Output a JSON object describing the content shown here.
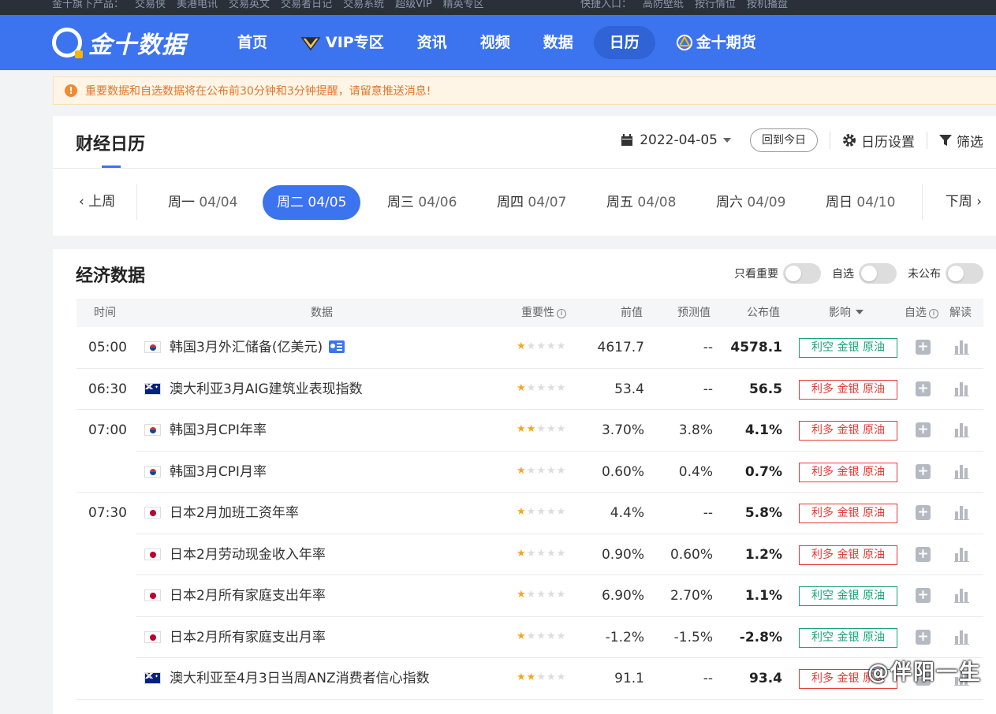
{
  "topbar": {
    "items": [
      "金十旗下产品：",
      "交易侠",
      "美港电讯",
      "交易英文",
      "交易者日记",
      "交易系统",
      "超级VIP",
      "精英专区"
    ],
    "quick": [
      "快捷入口：",
      "高防壁纸",
      "按行情位",
      "按机播盘"
    ]
  },
  "brand": {
    "name": "金十数据",
    "primary_color": "#3c74ef"
  },
  "nav": {
    "items": [
      {
        "label": "首页"
      },
      {
        "label": "VIP专区",
        "icon": "vip-diamond-icon"
      },
      {
        "label": "资讯"
      },
      {
        "label": "视频"
      },
      {
        "label": "数据"
      },
      {
        "label": "日历",
        "active": true
      },
      {
        "label": "金十期货",
        "icon": "futures-logo-icon"
      }
    ]
  },
  "notice": {
    "text": "重要数据和自选数据将在公布前30分钟和3分钟提醒，请留意推送消息!"
  },
  "calendar": {
    "title": "财经日历",
    "date": "2022-04-05",
    "today_button": "回到今日",
    "settings": "日历设置",
    "filter": "筛选",
    "prev_week": "上周",
    "next_week": "下周",
    "days": [
      {
        "wd": "周一",
        "date": "04/04"
      },
      {
        "wd": "周二",
        "date": "04/05",
        "active": true
      },
      {
        "wd": "周三",
        "date": "04/06"
      },
      {
        "wd": "周四",
        "date": "04/07"
      },
      {
        "wd": "周五",
        "date": "04/08"
      },
      {
        "wd": "周六",
        "date": "04/09"
      },
      {
        "wd": "周日",
        "date": "04/10"
      }
    ]
  },
  "econ": {
    "title": "经济数据",
    "toggles": [
      "只看重要",
      "自选",
      "未公布"
    ],
    "headers": {
      "time": "时间",
      "data": "数据",
      "importance": "重要性",
      "prev": "前值",
      "forecast": "预测值",
      "actual": "公布值",
      "impact": "影响",
      "watch": "自选",
      "interpret": "解读"
    },
    "rows": [
      {
        "time": "05:00",
        "flag": "kr",
        "name": "韩国3月外汇储备(亿美元)",
        "news": true,
        "stars": 1,
        "prev": "4617.7",
        "forecast": "--",
        "actual": "4578.1",
        "impact": "利空 金银 原油",
        "bull": false
      },
      {
        "time": "06:30",
        "flag": "au",
        "name": "澳大利亚3月AIG建筑业表现指数",
        "stars": 1,
        "prev": "53.4",
        "forecast": "--",
        "actual": "56.5",
        "impact": "利多 金银 原油",
        "bull": true
      },
      {
        "time": "07:00",
        "flag": "kr",
        "name": "韩国3月CPI年率",
        "stars": 2,
        "prev": "3.70%",
        "forecast": "3.8%",
        "actual": "4.1%",
        "impact": "利多 金银 原油",
        "bull": true
      },
      {
        "time": "",
        "flag": "kr",
        "name": "韩国3月CPI月率",
        "stars": 1,
        "prev": "0.60%",
        "forecast": "0.4%",
        "actual": "0.7%",
        "impact": "利多 金银 原油",
        "bull": true
      },
      {
        "time": "07:30",
        "flag": "jp",
        "name": "日本2月加班工资年率",
        "stars": 1,
        "prev": "4.4%",
        "forecast": "--",
        "actual": "5.8%",
        "impact": "利多 金银 原油",
        "bull": true
      },
      {
        "time": "",
        "flag": "jp",
        "name": "日本2月劳动现金收入年率",
        "stars": 1,
        "prev": "0.90%",
        "forecast": "0.60%",
        "actual": "1.2%",
        "impact": "利多 金银 原油",
        "bull": true
      },
      {
        "time": "",
        "flag": "jp",
        "name": "日本2月所有家庭支出年率",
        "stars": 1,
        "prev": "6.90%",
        "forecast": "2.70%",
        "actual": "1.1%",
        "impact": "利空 金银 原油",
        "bull": false
      },
      {
        "time": "",
        "flag": "jp",
        "name": "日本2月所有家庭支出月率",
        "stars": 1,
        "prev": "-1.2%",
        "forecast": "-1.5%",
        "actual": "-2.8%",
        "impact": "利空 金银 原油",
        "bull": false
      },
      {
        "time": "",
        "flag": "au",
        "name": "澳大利亚至4月3日当周ANZ消费者信心指数",
        "stars": 2,
        "prev": "91.1",
        "forecast": "--",
        "actual": "93.4",
        "impact": "利多 金银 原油",
        "bull": true
      }
    ]
  },
  "watermark": "@伴阳一生"
}
